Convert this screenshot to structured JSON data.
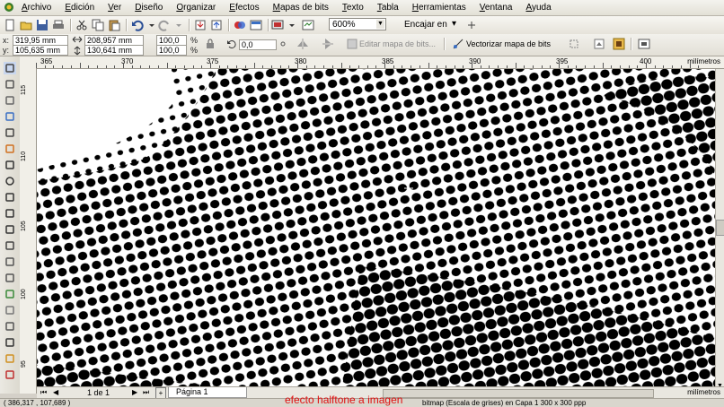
{
  "menu": [
    "Archivo",
    "Edición",
    "Ver",
    "Diseño",
    "Organizar",
    "Efectos",
    "Mapas de bits",
    "Texto",
    "Tabla",
    "Herramientas",
    "Ventana",
    "Ayuda"
  ],
  "toolbar": {
    "zoom_value": "600%",
    "snap_label": "Encajar en",
    "zoom_arrow": "▼",
    "snap_arrow": "▾"
  },
  "properties": {
    "x": "319,95 mm",
    "y": "105,635 mm",
    "width": "208,957 mm",
    "height": "130,641 mm",
    "scale_x": "100,0",
    "scale_y": "100,0",
    "percent": "%",
    "rotation": "0,0",
    "edit_bitmap": "Editar mapa de bits...",
    "trace_bitmap": "Vectorizar mapa de bits"
  },
  "ruler": {
    "h_ticks": [
      "365",
      "370",
      "375",
      "380",
      "385",
      "390",
      "395",
      "400"
    ],
    "unit": "milímetros",
    "v_ticks": [
      "115",
      "110",
      "105",
      "100",
      "95"
    ],
    "v_unit": "milímetros"
  },
  "navigator": {
    "page_count": "1 de 1",
    "page_tab": "Página 1",
    "first": "⏮",
    "prev": "◀",
    "next": "▶",
    "last": "⏭"
  },
  "status": {
    "coords": "( 386,317 , 107,689 )",
    "info": "bitmap (Escala de grises) en Capa 1 300 x 300 ppp"
  },
  "caption": "efecto halftone a imagen",
  "colors": {
    "accent": "#e01010",
    "ui": "#d4d0c8"
  }
}
